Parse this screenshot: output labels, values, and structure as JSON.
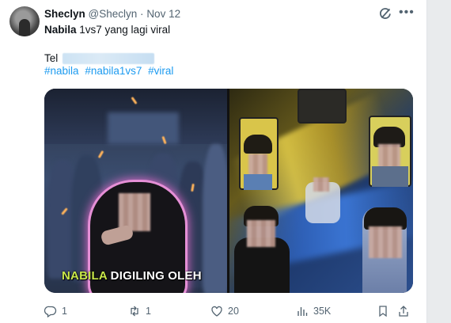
{
  "tweet": {
    "display_name": "Sheclyn",
    "handle": "@Sheclyn",
    "separator": "·",
    "date": "Nov 12",
    "title_bold": "Nabila",
    "title_rest": " 1vs7 yang lagi viral",
    "body_prefix": "Tel",
    "hashtags": [
      "#nabila",
      "#nabila1vs7",
      "#viral"
    ],
    "image_caption_highlight": "NABILA",
    "image_caption_rest": " DIGILING OLEH"
  },
  "actions": {
    "replies": "1",
    "reposts": "1",
    "likes": "20",
    "views": "35K"
  },
  "icons": {
    "grok": "grok-icon",
    "more": "more-icon",
    "reply": "reply-icon",
    "repost": "repost-icon",
    "like": "heart-icon",
    "views": "views-icon",
    "bookmark": "bookmark-icon",
    "share": "share-icon"
  },
  "colors": {
    "link": "#1d9bf0",
    "secondary_text": "#536471",
    "caption_highlight": "#c9e84a"
  }
}
